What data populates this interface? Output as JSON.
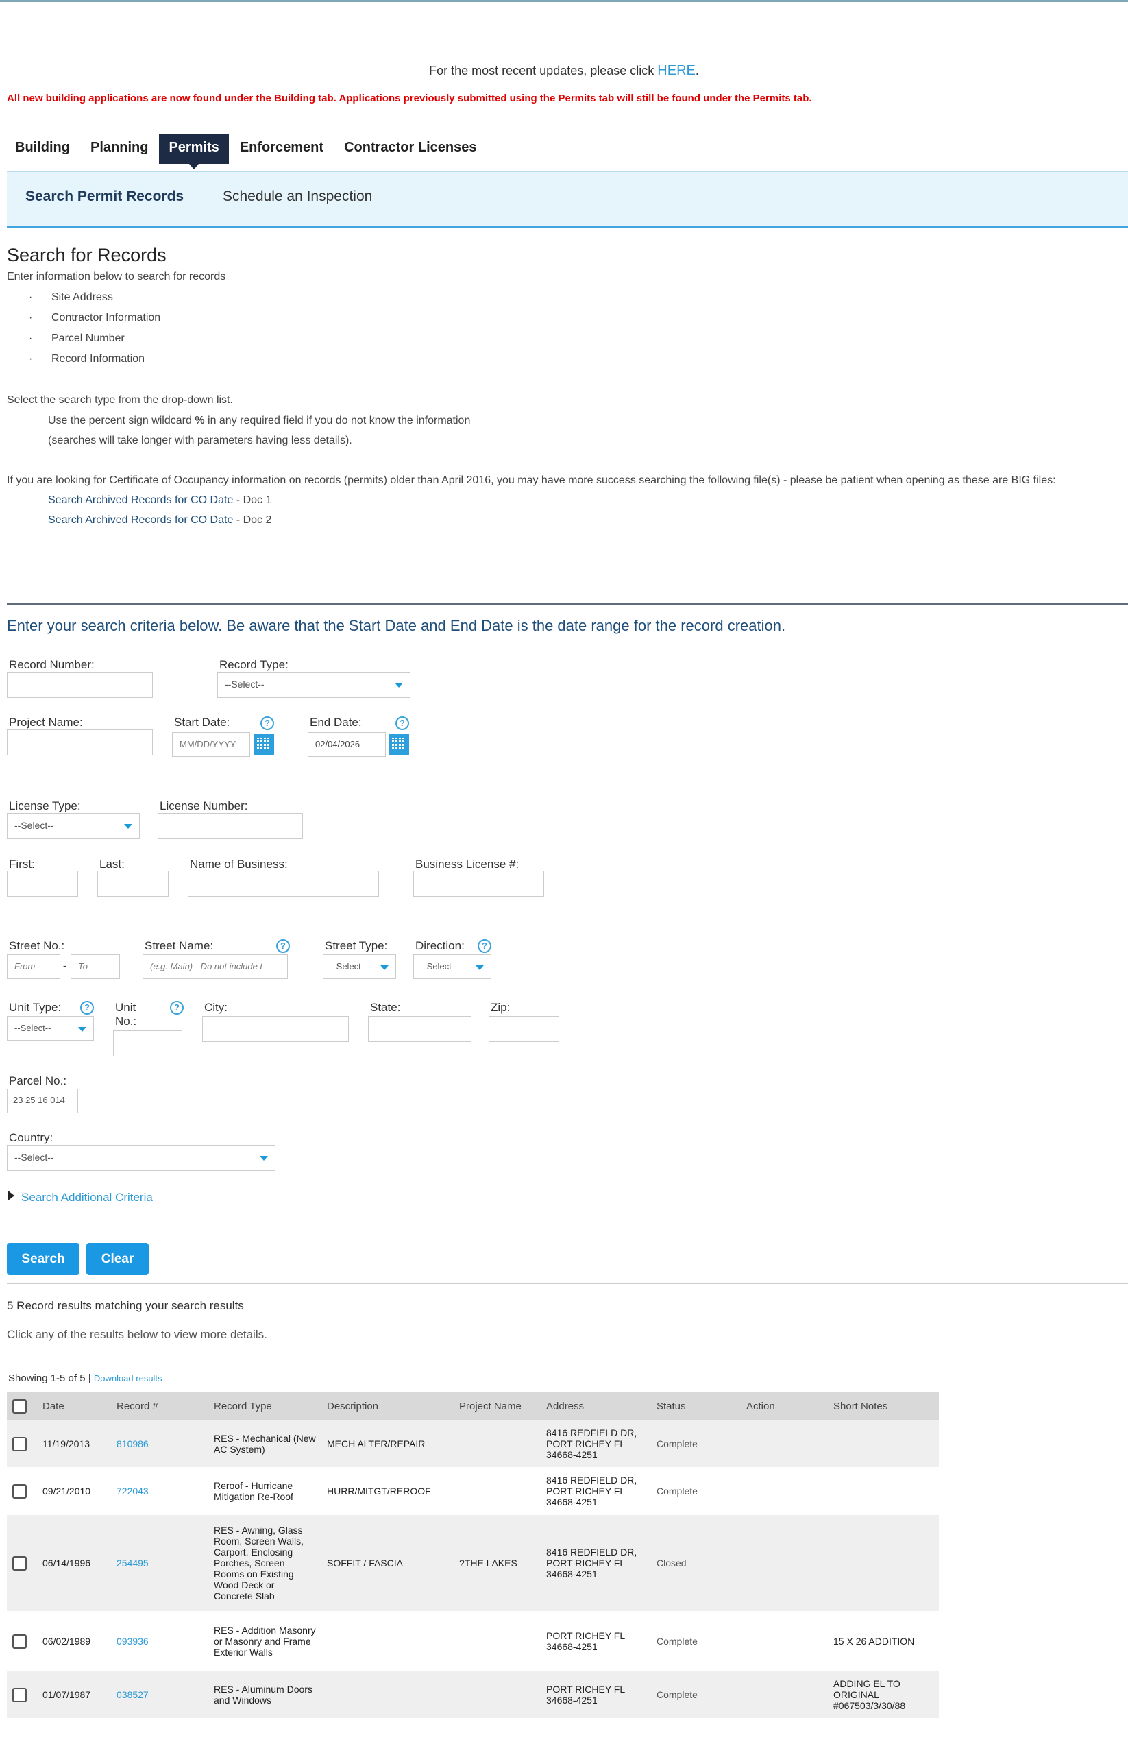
{
  "notice": {
    "text": "For the most recent updates, please click ",
    "link": "HERE",
    "suffix": "."
  },
  "alert": "All new building applications are now found under the Building tab.  Applications previously submitted using the Permits tab will still be found under the Permits tab.",
  "tabs": [
    "Building",
    "Planning",
    "Permits",
    "Enforcement",
    "Contractor Licenses"
  ],
  "active_tab": "Permits",
  "subtabs": [
    "Search Permit Records",
    "Schedule an Inspection"
  ],
  "intro": {
    "title": "Search for Records",
    "lead": "Enter information below to search for records",
    "bullets": [
      "Site Address",
      "Contractor Information",
      "Parcel Number",
      "Record Information"
    ],
    "select_text": "Select the search type from the drop-down list.",
    "wildcard_line1a": "Use the percent sign wildcard ",
    "wildcard_sym": "%",
    "wildcard_line1b": " in any required field if you do not know the information",
    "wildcard_line2": "(searches will take longer with parameters having less details).",
    "co_text": "If you are looking for Certificate of Occupancy information on records (permits) older than April 2016, you may have more success searching the following file(s) - please be patient when opening as these are BIG files:",
    "archive_links": [
      {
        "label": "Search Archived Records for CO Date",
        "doc": " - Doc 1"
      },
      {
        "label": "Search Archived Records for CO Date",
        "doc": " - Doc 2"
      }
    ]
  },
  "criteria_heading": "Enter your search criteria below. Be aware that the Start Date and End Date is the date range for the record creation.",
  "form": {
    "record_number_label": "Record Number:",
    "record_type_label": "Record Type:",
    "select_text": "--Select--",
    "project_name_label": "Project Name:",
    "start_date_label": "Start Date:",
    "start_date_placeholder": "MM/DD/YYYY",
    "end_date_label": "End Date:",
    "end_date_value": "02/04/2026",
    "license_type_label": "License Type:",
    "license_number_label": "License Number:",
    "first_label": "First:",
    "last_label": "Last:",
    "business_name_label": "Name of Business:",
    "business_license_label": "Business License #:",
    "street_no_label": "Street No.:",
    "street_from_placeholder": "From",
    "street_to_placeholder": "To",
    "street_dash": "-",
    "street_name_label": "Street Name:",
    "street_name_placeholder": "(e.g. Main) - Do not include t",
    "street_type_label": "Street Type:",
    "direction_label": "Direction:",
    "unit_type_label": "Unit Type:",
    "unit_no_label": "Unit No.:",
    "city_label": "City:",
    "state_label": "State:",
    "zip_label": "Zip:",
    "parcel_label": "Parcel No.:",
    "parcel_value": "23 25 16 014",
    "country_label": "Country:",
    "additional_criteria": "Search Additional Criteria",
    "help_glyph": "?"
  },
  "buttons": {
    "search": "Search",
    "clear": "Clear"
  },
  "results": {
    "count_text": "5 Record results matching your search results",
    "click_text": "Click any of the results below to view more details.",
    "showing": "Showing 1-5 of 5",
    "pipe": "|",
    "download": "Download results",
    "headers": [
      "Date",
      "Record #",
      "Record Type",
      "Description",
      "Project Name",
      "Address",
      "Status",
      "Action",
      "Short Notes"
    ],
    "rows": [
      {
        "date": "11/19/2013",
        "record": "810986",
        "type": "RES - Mechanical (New AC System)",
        "desc": "MECH ALTER/REPAIR",
        "project": "",
        "address": "8416 REDFIELD DR, PORT RICHEY FL 34668-4251",
        "status": "Complete",
        "action": "",
        "notes": ""
      },
      {
        "date": "09/21/2010",
        "record": "722043",
        "type": "Reroof - Hurricane Mitigation Re-Roof",
        "desc": "HURR/MITGT/REROOF",
        "project": "",
        "address": "8416 REDFIELD DR, PORT RICHEY FL 34668-4251",
        "status": "Complete",
        "action": "",
        "notes": ""
      },
      {
        "date": "06/14/1996",
        "record": "254495",
        "type": "RES - Awning, Glass Room, Screen Walls, Carport, Enclosing Porches, Screen Rooms on Existing Wood Deck or Concrete Slab",
        "desc": "SOFFIT / FASCIA",
        "project": "?THE LAKES",
        "address": "8416 REDFIELD DR, PORT RICHEY FL 34668-4251",
        "status": "Closed",
        "action": "",
        "notes": ""
      },
      {
        "date": "06/02/1989",
        "record": "093936",
        "type": "RES - Addition Masonry or Masonry and Frame Exterior Walls",
        "desc": "",
        "project": "",
        "address": "PORT RICHEY FL 34668-4251",
        "status": "Complete",
        "action": "",
        "notes": "15 X 26 ADDITION"
      },
      {
        "date": "01/07/1987",
        "record": "038527",
        "type": "RES - Aluminum Doors and Windows",
        "desc": "",
        "project": "",
        "address": "PORT RICHEY FL 34668-4251",
        "status": "Complete",
        "action": "",
        "notes": "ADDING EL TO ORIGINAL #067503/3/30/88"
      }
    ]
  }
}
